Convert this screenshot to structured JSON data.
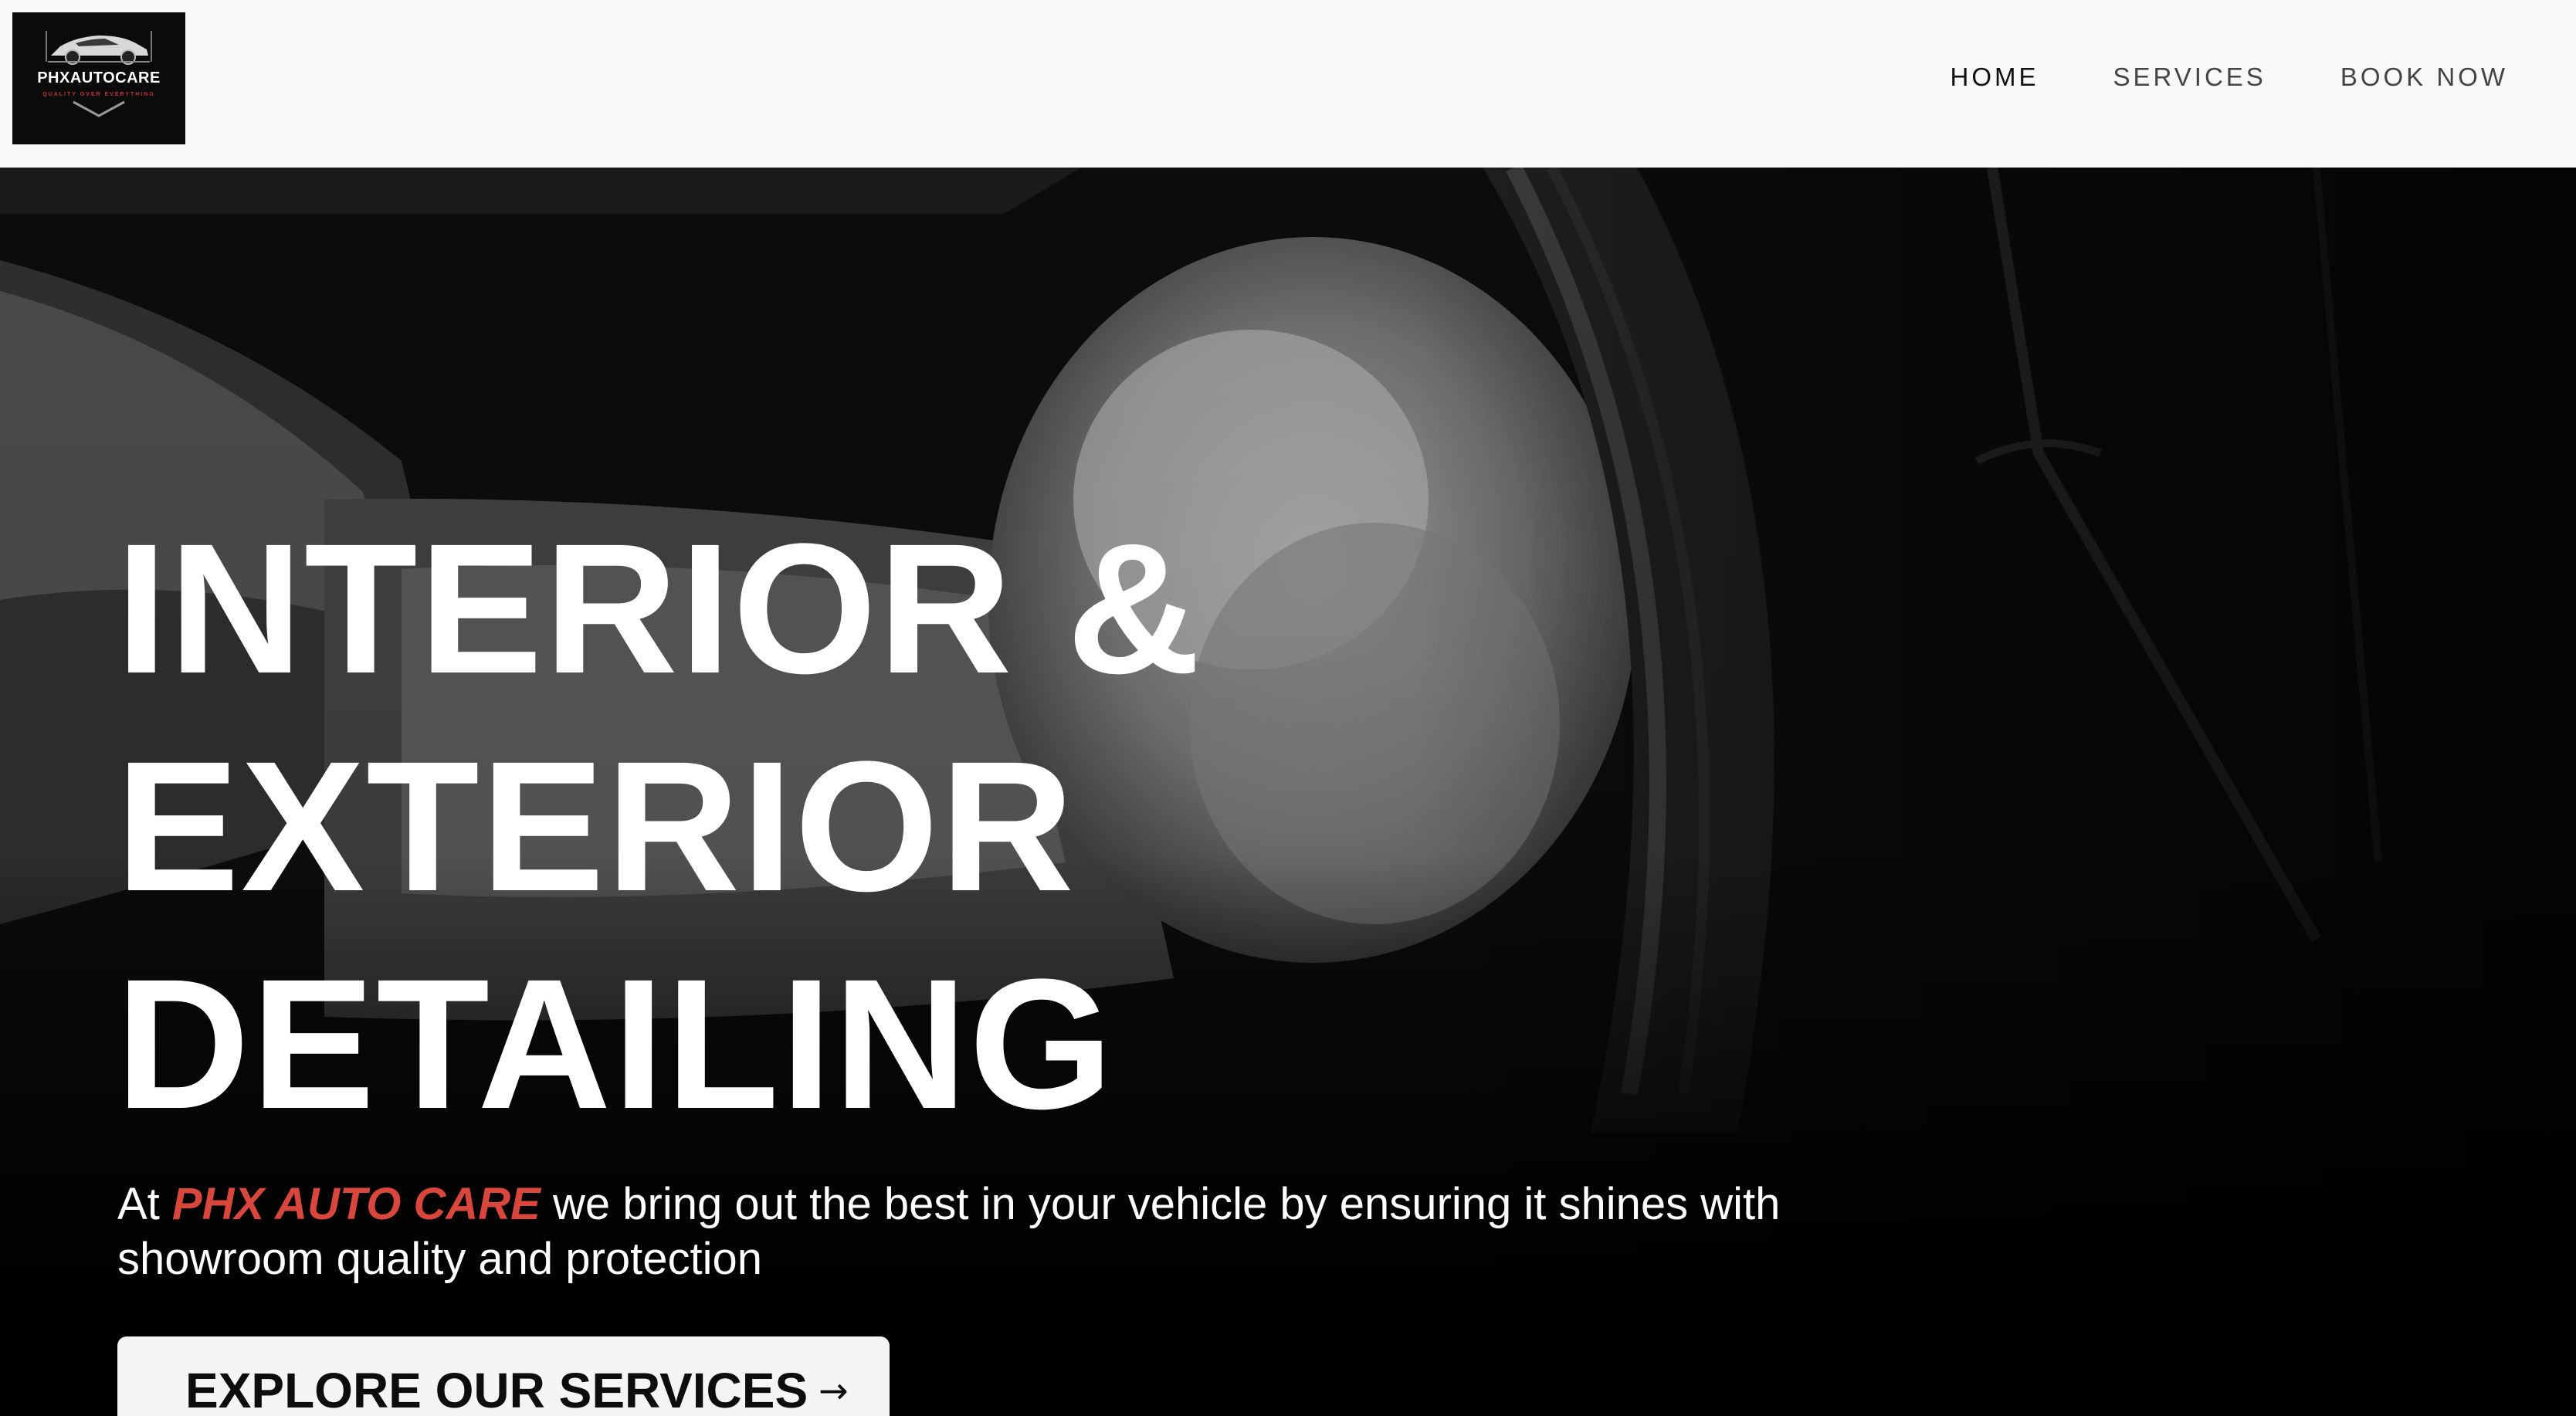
{
  "header": {
    "logo": {
      "title": "PHXAUTOCARE",
      "tagline": "QUALITY OVER EVERYTHING",
      "icon": "sports-car-emblem-icon"
    },
    "nav": [
      {
        "label": "HOME",
        "active": true
      },
      {
        "label": "SERVICES",
        "active": false
      },
      {
        "label": "BOOK NOW",
        "active": false
      }
    ]
  },
  "hero": {
    "image": "grayscale-foam-wash-mitt-on-car-tire",
    "headline": [
      "INTERIOR &",
      "EXTERIOR",
      "DETAILING"
    ],
    "intro": {
      "prefix": "At ",
      "brand": "PHX AUTO CARE",
      "rest": " we bring out the best in your vehicle by ensuring it shines with showroom quality and protection"
    },
    "cta": {
      "label": "EXPLORE OUR SERVICES",
      "icon": "arrow-right-icon"
    }
  },
  "colors": {
    "header_bg": "#f7f8fa",
    "hero_bg": "#000000",
    "brand_accent": "#d9463b",
    "cta_bg": "#f5f5f6"
  }
}
